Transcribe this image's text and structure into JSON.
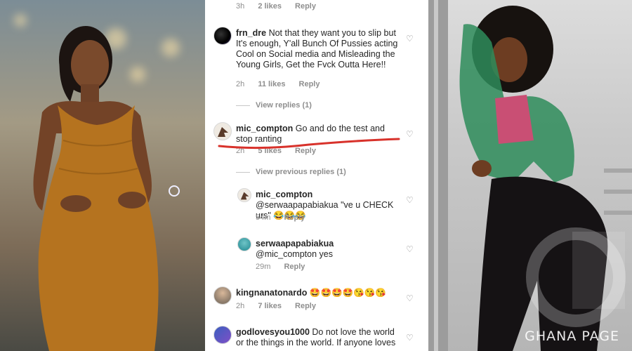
{
  "comments": [
    {
      "id": "c0",
      "username": "",
      "text": "",
      "time": "3h",
      "likes": "2 likes",
      "reply": "Reply"
    },
    {
      "id": "c1",
      "username": "frn_dre",
      "text": "Not that they want you to slip but It's enough, Y'all Bunch Of Pussies acting Cool on Social media and Misleading the Young Girls, Get the Fvck Outta Here!!",
      "time": "2h",
      "likes": "11 likes",
      "reply": "Reply",
      "view_replies": "View replies (1)"
    },
    {
      "id": "c2",
      "username": "mic_compton",
      "text": "Go and do the test and stop ranting",
      "time": "2h",
      "likes": "5 likes",
      "reply": "Reply",
      "view_replies": "View previous replies (1)"
    },
    {
      "id": "r1",
      "username": "mic_compton",
      "text": "@serwaapapabiakua \"ve u CHECK urs\" 😂😂😂",
      "time": "54m",
      "reply": "Reply"
    },
    {
      "id": "r2",
      "username": "serwaapapabiakua",
      "text": "@mic_compton yes",
      "time": "29m",
      "reply": "Reply"
    },
    {
      "id": "c3",
      "username": "kingnanatonardo",
      "text": "🤩🤩🤩🤩😘😘😘",
      "time": "2h",
      "likes": "7 likes",
      "reply": "Reply"
    },
    {
      "id": "c4",
      "username": "godlovesyou1000",
      "text": "Do not love the world or the things in the world. If anyone loves"
    }
  ],
  "icons": {
    "like": "heart-icon"
  },
  "colors": {
    "highlight": "#d8322b",
    "text": "#262626",
    "meta": "#8e8e8e"
  },
  "watermark": {
    "brand": "GHANA PAGE"
  }
}
